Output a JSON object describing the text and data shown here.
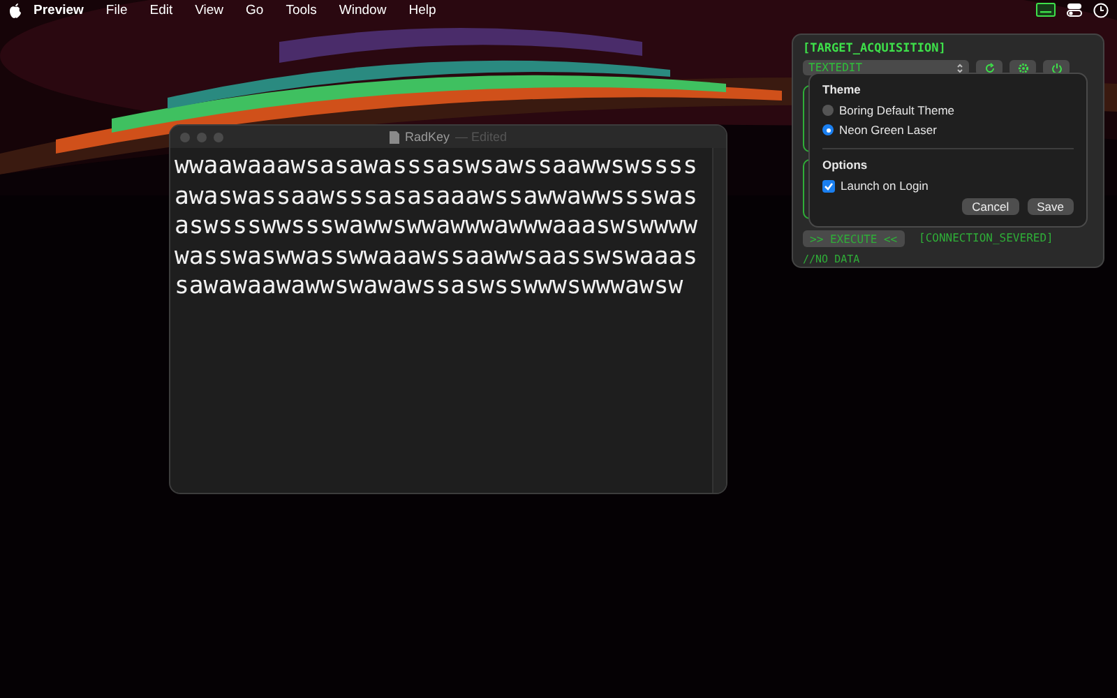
{
  "menu_bar": {
    "app": "Preview",
    "menus": [
      "File",
      "Edit",
      "View",
      "Go",
      "Tools",
      "Window",
      "Help"
    ]
  },
  "editor_window": {
    "title": "RadKey",
    "status": "— Edited",
    "lines": [
      "wwaawaaawsasawasssaswsawssaawwswssss",
      "awaswassaawsssasasaaawssawwawwssswas",
      "aswssswwssswawwswwawwwawwwaaaswswwww",
      "wasswaswwasswwaaawssaawwsaasswswaaas",
      "sawawaawawwswawawssaswsswwwswwwawsw"
    ]
  },
  "panel": {
    "heading": "[TARGET_ACQUISITION]",
    "target": "TEXTEDIT",
    "execute": ">> EXECUTE <<",
    "connection": "[CONNECTION_SEVERED]",
    "output": "//NO DATA"
  },
  "settings": {
    "theme_heading": "Theme",
    "themes": [
      {
        "label": "Boring Default Theme",
        "selected": false
      },
      {
        "label": "Neon Green Laser",
        "selected": true
      }
    ],
    "options_heading": "Options",
    "options": [
      {
        "label": "Launch on Login",
        "checked": true
      }
    ],
    "buttons": [
      "Cancel",
      "Save"
    ]
  }
}
